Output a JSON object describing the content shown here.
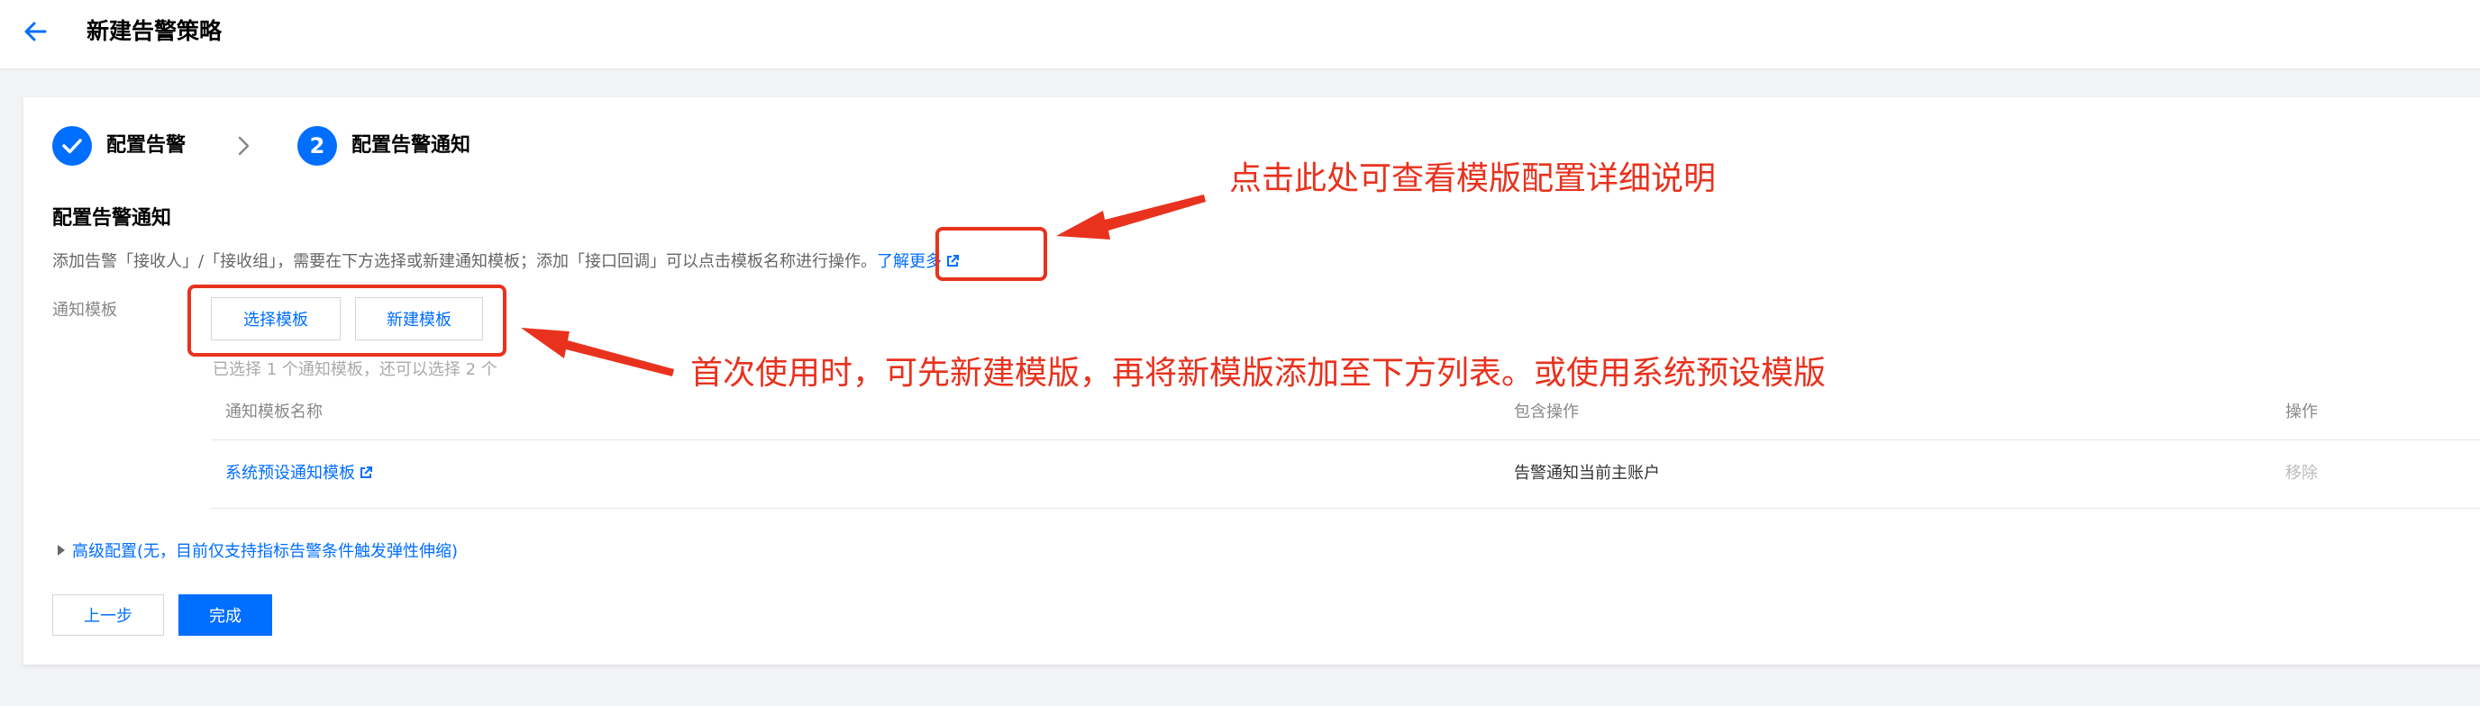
{
  "header": {
    "title": "新建告警策略",
    "back_icon": "arrow-left-icon"
  },
  "stepper": {
    "steps": [
      {
        "label": "配置告警",
        "state": "done"
      },
      {
        "label": "配置告警通知",
        "number": "2",
        "state": "active"
      }
    ]
  },
  "section": {
    "title": "配置告警通知",
    "description": "添加告警「接收人」/「接收组」，需要在下方选择或新建通知模板；添加「接口回调」可以点击模板名称进行操作。",
    "learn_more": "了解更多"
  },
  "template_field": {
    "label": "通知模板",
    "select_button": "选择模板",
    "new_button": "新建模板",
    "hint": "已选择 1 个通知模板，还可以选择 2 个"
  },
  "table": {
    "headers": [
      "通知模板名称",
      "包含操作",
      "操作"
    ],
    "rows": [
      {
        "name": "系统预设通知模板",
        "ops": "告警通知当前主账户",
        "action": "移除"
      }
    ]
  },
  "advanced": "高级配置(无，目前仅支持指标告警条件触发弹性伸缩)",
  "footer": {
    "prev": "上一步",
    "done": "完成"
  },
  "annotations": {
    "top": "点击此处可查看模版配置详细说明",
    "bottom": "首次使用时，可先新建模版，再将新模版添加至下方列表。或使用系统预设模版"
  },
  "colors": {
    "primary": "#006eff",
    "annotation": "#e8321e"
  }
}
